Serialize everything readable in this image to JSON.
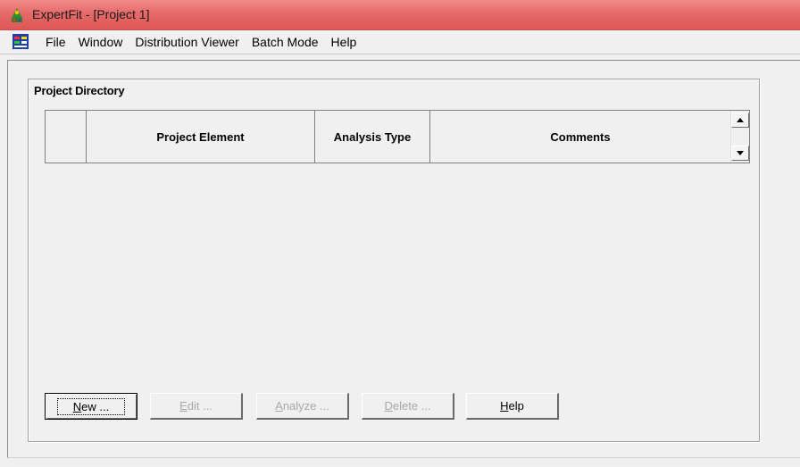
{
  "window": {
    "title": "ExpertFit - [Project 1]"
  },
  "menu": {
    "items": [
      "File",
      "Window",
      "Distribution Viewer",
      "Batch Mode",
      "Help"
    ]
  },
  "project_directory": {
    "title": "Project Directory",
    "columns": [
      "",
      "Project Element",
      "Analysis Type",
      "Comments"
    ]
  },
  "buttons": {
    "new": {
      "mnemonic": "N",
      "rest": "ew ..."
    },
    "edit": {
      "mnemonic": "E",
      "rest": "dit ..."
    },
    "analyze": {
      "mnemonic": "A",
      "rest": "nalyze ..."
    },
    "delete": {
      "mnemonic": "D",
      "rest": "elete ..."
    },
    "help": {
      "mnemonic": "H",
      "rest": "elp"
    }
  },
  "icons": {
    "app": "expertfit-app-icon",
    "menu": "mdi-child-system-icon"
  },
  "colors": {
    "titlebar": "#e66a6a",
    "window_bg": "#f0f0f0",
    "disabled_text": "#a8a8a8"
  }
}
